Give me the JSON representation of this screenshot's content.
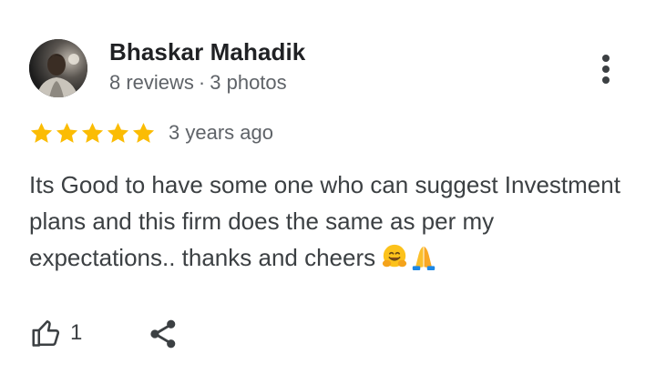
{
  "review": {
    "reviewer": {
      "name": "Bhaskar Mahadik",
      "reviews_count": "8 reviews",
      "separator": "·",
      "photos_count": "3 photos",
      "avatar_icon": "user-avatar-photo"
    },
    "rating": 5,
    "rating_max": 5,
    "date": "3 years ago",
    "text": "Its Good to have some one who can suggest Investment plans and this firm does the same as per my expectations.. thanks and cheers",
    "emojis": [
      "hugging-face-emoji-icon",
      "folded-hands-emoji-icon"
    ],
    "actions": {
      "like_icon": "thumbs-up-icon",
      "like_count": "1",
      "share_icon": "share-icon",
      "more_icon": "more-vert-icon"
    }
  },
  "colors": {
    "star": "#fbbc04",
    "name": "#202124",
    "secondary": "#5f6368",
    "body": "#3c4043"
  }
}
